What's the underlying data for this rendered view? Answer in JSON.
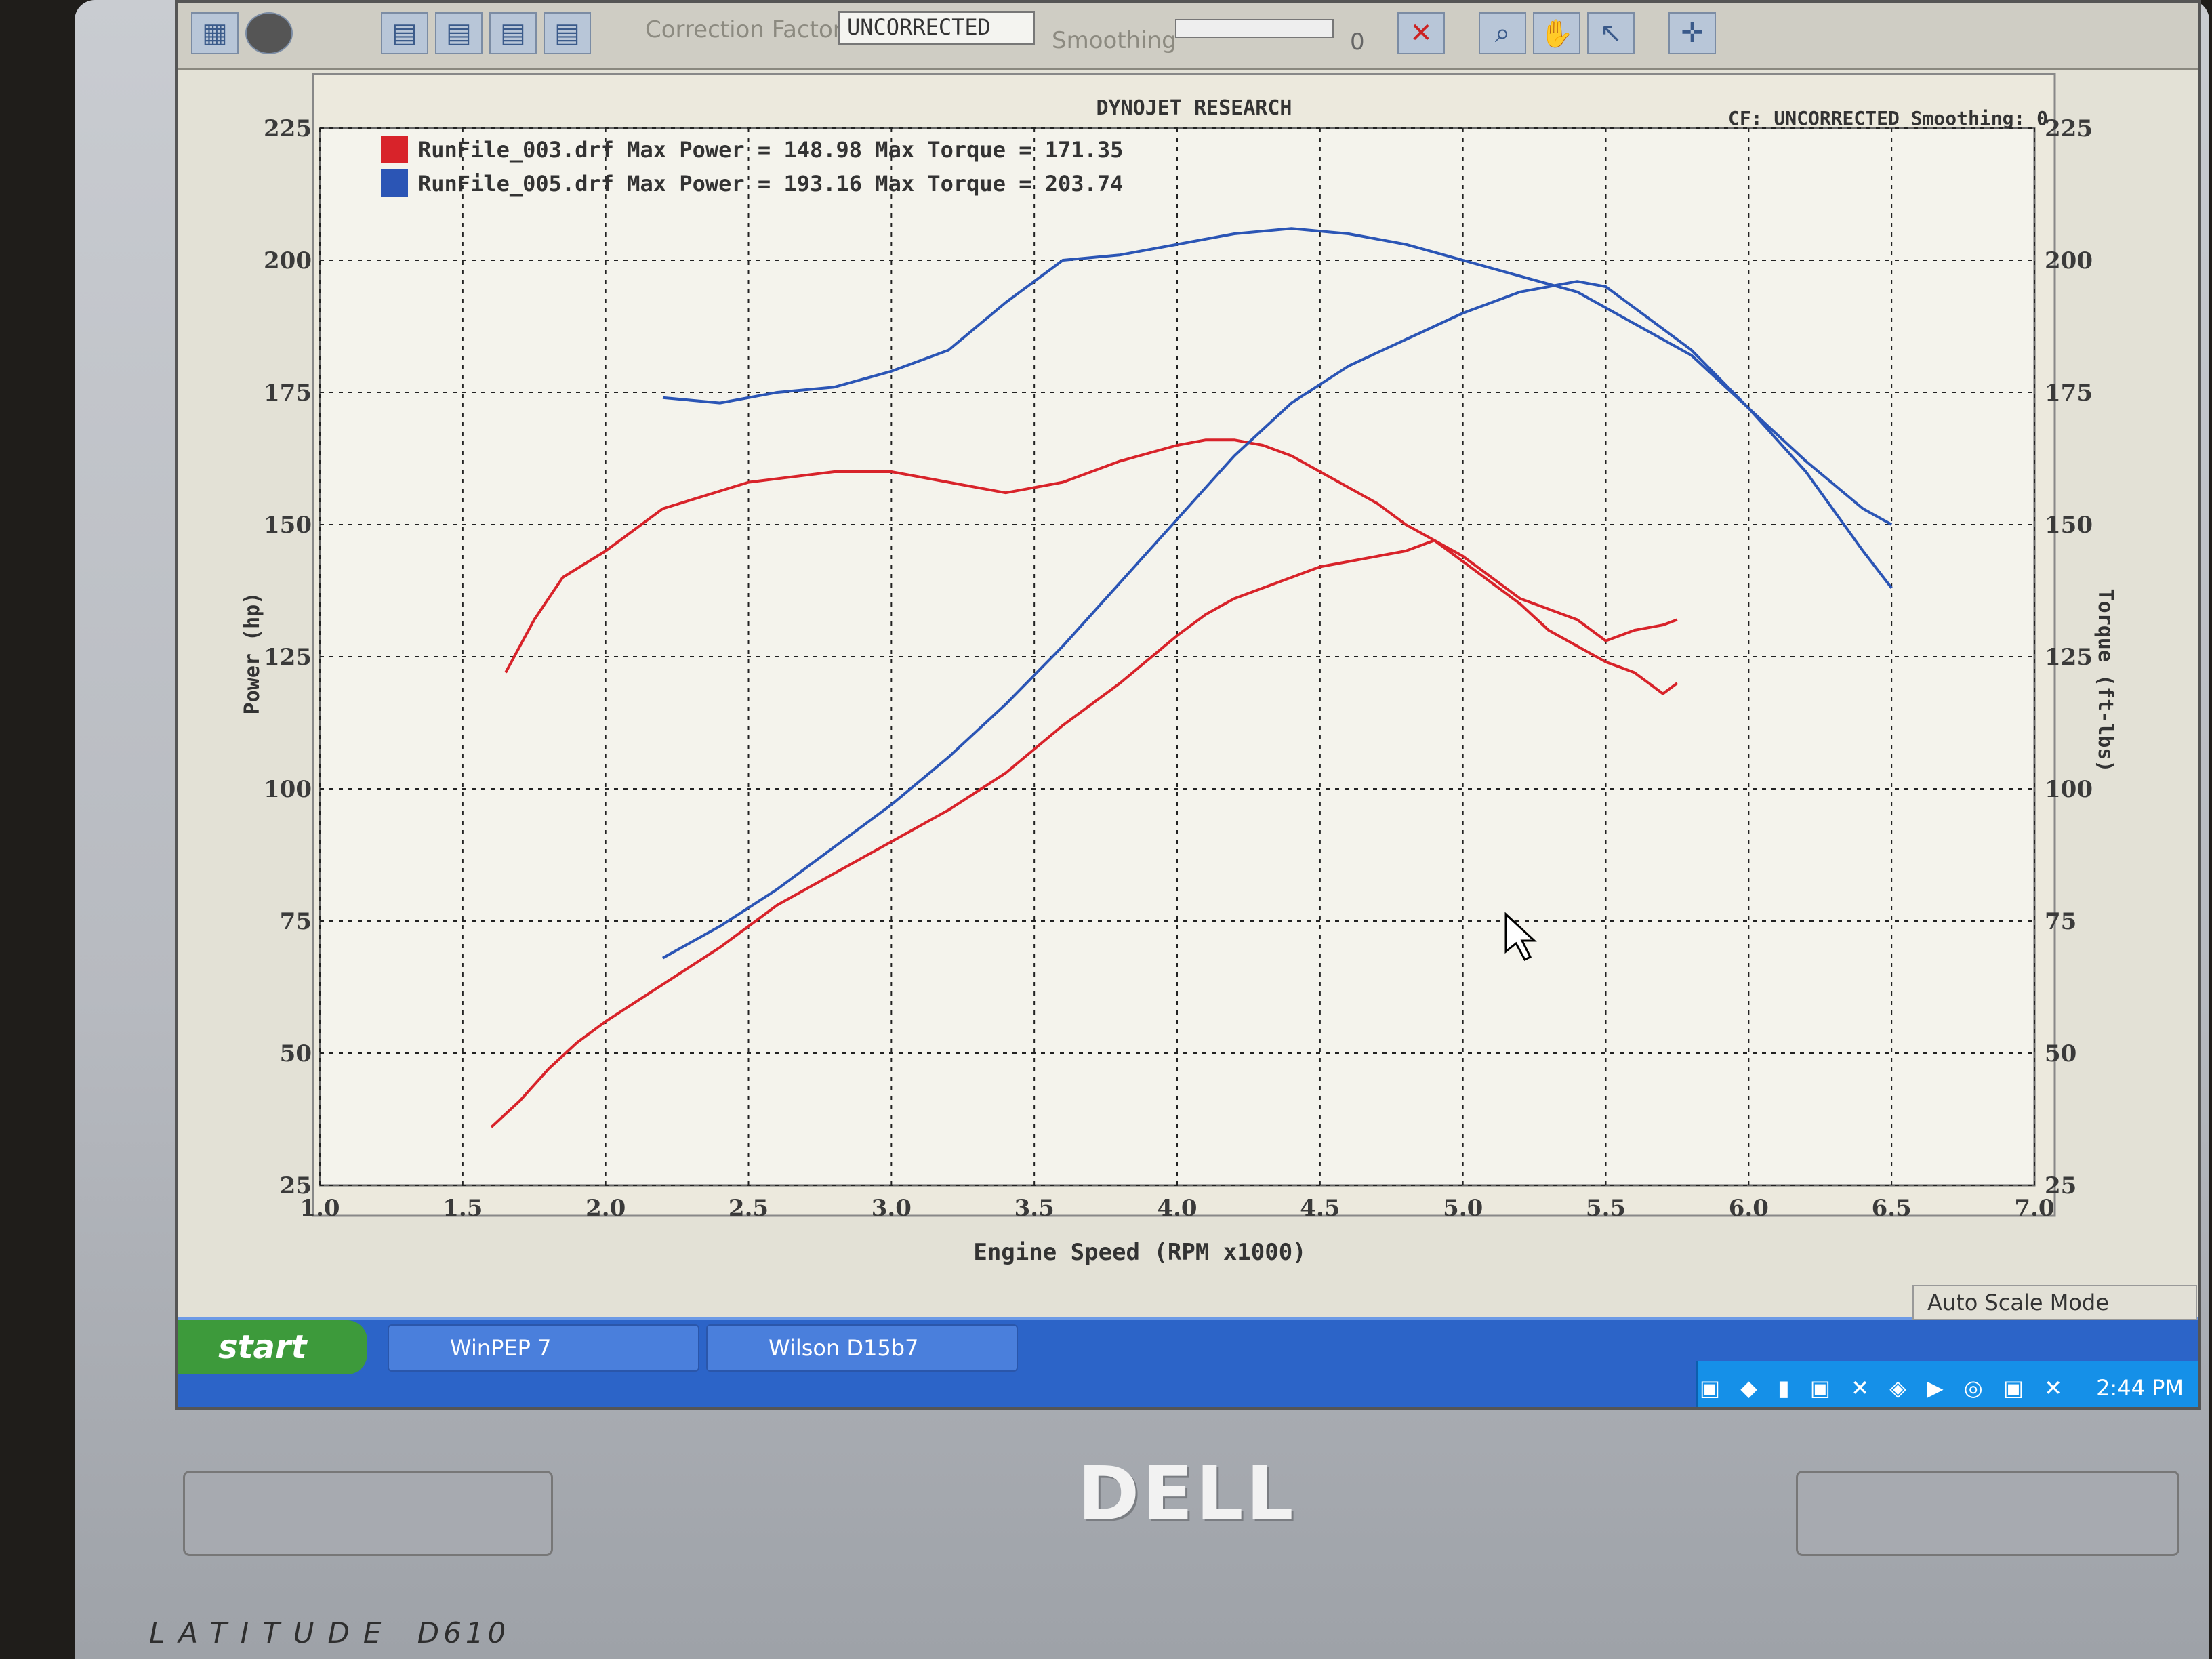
{
  "toolbar": {
    "correction_label": "Correction Factor",
    "correction_value": "UNCORRECTED",
    "smoothing_label": "Smoothing",
    "smoothing_value": "0"
  },
  "chart_header": {
    "title": "DYNOJET RESEARCH",
    "status": "CF: UNCORRECTED  Smoothing: 0"
  },
  "chart_data": {
    "type": "line",
    "title": "DYNOJET RESEARCH",
    "xlabel": "Engine Speed (RPM x1000)",
    "ylabel": "Power (hp)",
    "y2label": "Torque (ft-lbs)",
    "xlim": [
      1.0,
      7.0
    ],
    "ylim": [
      25,
      225
    ],
    "y2lim": [
      25,
      225
    ],
    "xticks": [
      "1.0",
      "1.5",
      "2.0",
      "2.5",
      "3.0",
      "3.5",
      "4.0",
      "4.5",
      "5.0",
      "5.5",
      "6.0",
      "6.5",
      "7.0"
    ],
    "yticks": [
      "25",
      "50",
      "75",
      "100",
      "125",
      "150",
      "175",
      "200",
      "225"
    ],
    "grid": true,
    "legend_position": "top-left",
    "legend": [
      {
        "label": "RunFile_003.drf Max Power = 148.98 Max Torque = 171.35",
        "color": "#d8232a"
      },
      {
        "label": "RunFile_005.drf Max Power = 193.16 Max Torque = 203.74",
        "color": "#2b55b5"
      }
    ],
    "series": [
      {
        "key": "run003_power",
        "color": "#d8232a",
        "x": [
          1.6,
          1.7,
          1.8,
          1.9,
          2.0,
          2.2,
          2.4,
          2.6,
          2.8,
          3.0,
          3.2,
          3.4,
          3.6,
          3.8,
          4.0,
          4.1,
          4.2,
          4.3,
          4.4,
          4.5,
          4.6,
          4.7,
          4.8,
          4.9,
          5.0,
          5.1,
          5.2,
          5.3,
          5.4,
          5.5,
          5.6,
          5.7,
          5.75
        ],
        "y": [
          36,
          41,
          47,
          52,
          56,
          63,
          70,
          78,
          84,
          90,
          96,
          103,
          112,
          120,
          129,
          133,
          136,
          138,
          140,
          142,
          143,
          144,
          145,
          147,
          143,
          139,
          135,
          130,
          127,
          124,
          122,
          118,
          120
        ]
      },
      {
        "key": "run003_torque",
        "color": "#d8232a",
        "x": [
          1.65,
          1.75,
          1.85,
          2.0,
          2.2,
          2.5,
          2.8,
          3.0,
          3.2,
          3.4,
          3.6,
          3.8,
          4.0,
          4.1,
          4.2,
          4.3,
          4.4,
          4.5,
          4.6,
          4.7,
          4.8,
          4.9,
          5.0,
          5.1,
          5.2,
          5.3,
          5.4,
          5.5,
          5.6,
          5.7,
          5.75
        ],
        "y": [
          122,
          132,
          140,
          145,
          153,
          158,
          160,
          160,
          158,
          156,
          158,
          162,
          165,
          166,
          166,
          165,
          163,
          160,
          157,
          154,
          150,
          147,
          144,
          140,
          136,
          134,
          132,
          128,
          130,
          131,
          132
        ]
      },
      {
        "key": "run005_power",
        "color": "#2b55b5",
        "x": [
          2.2,
          2.4,
          2.6,
          2.8,
          3.0,
          3.2,
          3.4,
          3.6,
          3.8,
          4.0,
          4.2,
          4.4,
          4.6,
          4.8,
          5.0,
          5.2,
          5.4,
          5.5,
          5.6,
          5.8,
          6.0,
          6.2,
          6.4,
          6.5
        ],
        "y": [
          68,
          74,
          81,
          89,
          97,
          106,
          116,
          127,
          139,
          151,
          163,
          173,
          180,
          185,
          190,
          194,
          196,
          195,
          191,
          183,
          172,
          160,
          145,
          138
        ]
      },
      {
        "key": "run005_torque",
        "color": "#2b55b5",
        "x": [
          2.2,
          2.4,
          2.6,
          2.8,
          3.0,
          3.2,
          3.4,
          3.6,
          3.8,
          4.0,
          4.2,
          4.4,
          4.6,
          4.8,
          5.0,
          5.2,
          5.4,
          5.6,
          5.8,
          6.0,
          6.2,
          6.4,
          6.5
        ],
        "y": [
          174,
          173,
          175,
          176,
          179,
          183,
          192,
          200,
          201,
          203,
          205,
          206,
          205,
          203,
          200,
          197,
          194,
          188,
          182,
          172,
          162,
          153,
          150
        ]
      }
    ]
  },
  "taskbar": {
    "start": "start",
    "item1": "WinPEP 7",
    "item2": "Wilson D15b7",
    "mode": "Auto Scale Mode",
    "time": "2:44 PM"
  },
  "laptop": {
    "brand": "DELL",
    "model": "LATITUDE",
    "model_no": "D610"
  }
}
